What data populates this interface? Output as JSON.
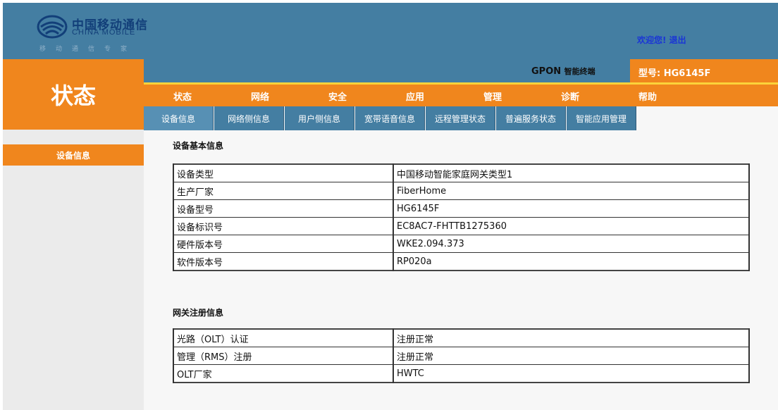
{
  "header": {
    "logo_cn": "中国移动通信",
    "logo_en": "CHINA MOBILE",
    "logo_slogan": "移动通信专家",
    "welcome": "欢迎您!",
    "logout": "退出"
  },
  "left_title": "状态",
  "infobar": {
    "gpon_prefix": "GPON",
    "gpon_suffix": "智能终端",
    "model_label": "型号:",
    "model_value": "HG6145F"
  },
  "main_nav": [
    "状态",
    "网络",
    "安全",
    "应用",
    "管理",
    "诊断",
    "帮助"
  ],
  "sub_nav": [
    "设备信息",
    "网络侧信息",
    "用户侧信息",
    "宽带语音信息",
    "远程管理状态",
    "普遍服务状态",
    "智能应用管理"
  ],
  "sidebar": {
    "items": [
      "设备信息"
    ]
  },
  "device_info": {
    "title": "设备基本信息",
    "rows": [
      {
        "key": "设备类型",
        "value": "中国移动智能家庭网关类型1"
      },
      {
        "key": "生产厂家",
        "value": "FiberHome"
      },
      {
        "key": "设备型号",
        "value": "HG6145F"
      },
      {
        "key": "设备标识号",
        "value": "EC8AC7-FHTTB1275360"
      },
      {
        "key": "硬件版本号",
        "value": "WKE2.094.373"
      },
      {
        "key": "软件版本号",
        "value": "RP020a"
      }
    ]
  },
  "registration_info": {
    "title": "网关注册信息",
    "rows": [
      {
        "key": "光路（OLT）认证",
        "value": "注册正常"
      },
      {
        "key": "管理（RMS）注册",
        "value": "注册正常"
      },
      {
        "key": "OLT厂家",
        "value": "HWTC"
      }
    ]
  },
  "colors": {
    "header_blue": "#447ea2",
    "orange": "#f0861d",
    "yellow_line": "#fbd33a",
    "link_blue": "#1a35d6"
  }
}
